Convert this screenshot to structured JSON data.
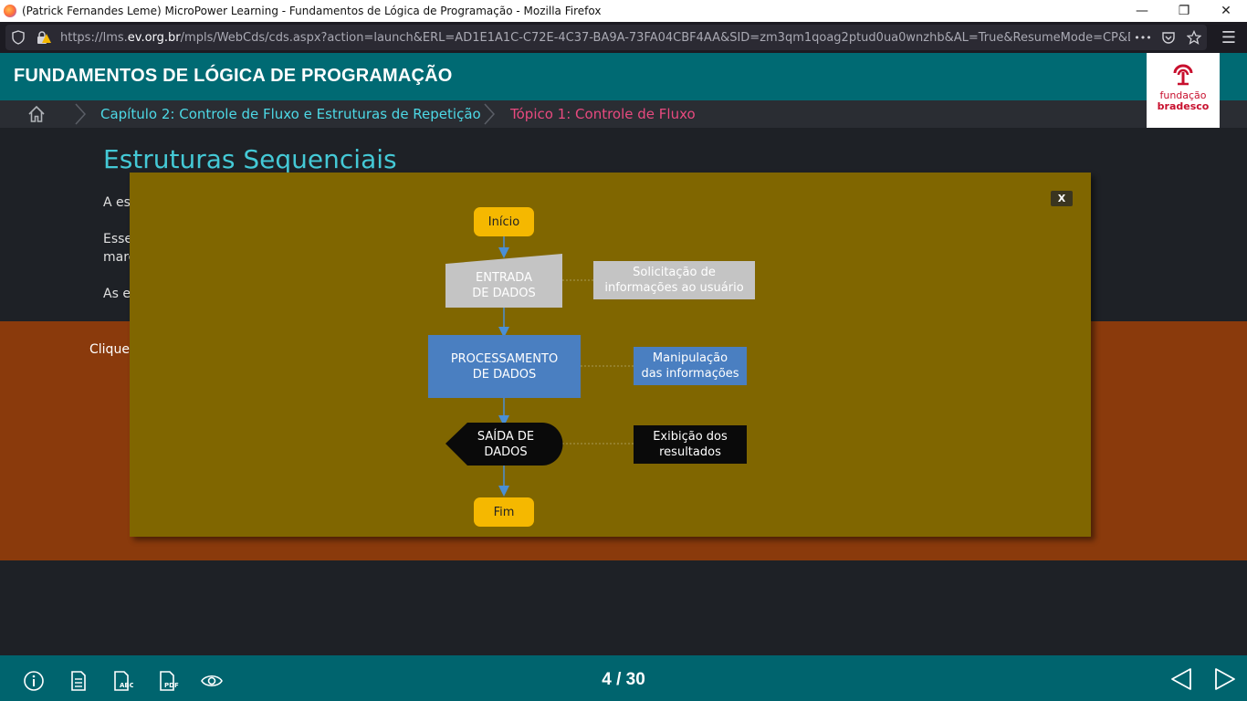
{
  "browser": {
    "window_title": "(Patrick Fernandes Leme) MicroPower Learning - Fundamentos de Lógica de Programação - Mozilla Firefox",
    "url_prefix": "https://lms.",
    "url_host": "ev.org.br",
    "url_rest": "/mpls/WebCds/cds.aspx?action=launch&ERL=AD1E1A1C-C72E-4C37-BA9A-73FA04CBF4AA&SID=zm3qm1qoag2ptud0ua0wnzhb&AL=True&ResumeMode=CP&DCM=A",
    "more": "•••"
  },
  "header": {
    "course_title": "FUNDAMENTOS DE LÓGICA DE PROGRAMAÇÃO",
    "logo_line1": "fundação",
    "logo_line2": "bradesco"
  },
  "breadcrumb": {
    "chapter": "Capítulo 2: Controle de Fluxo e Estruturas de Repetição",
    "topic": "Tópico 1: Controle de Fluxo"
  },
  "page": {
    "heading": "Estruturas Sequenciais",
    "para1": "A est",
    "para2a": "Esse",
    "para2b": "marc",
    "para3": "As es",
    "clique": "Clique"
  },
  "modal": {
    "close_label": "X",
    "flow": {
      "start": "Início",
      "input_l1": "ENTRADA",
      "input_l2": "DE DADOS",
      "input_note_l1": "Solicitação de",
      "input_note_l2": "informações ao usuário",
      "process_l1": "PROCESSAMENTO",
      "process_l2": "DE DADOS",
      "process_note_l1": "Manipulação",
      "process_note_l2": "das informações",
      "output_l1": "SAÍDA DE",
      "output_l2": "DADOS",
      "output_note_l1": "Exibição dos",
      "output_note_l2": "resultados",
      "end": "Fim"
    }
  },
  "footer": {
    "page_indicator": "4 / 30"
  },
  "colors": {
    "header_teal": "#006a73",
    "modal_olive": "#806600",
    "terminal_yellow": "#f5b800",
    "input_gray": "#c4c4c4",
    "process_blue": "#4a7fc1",
    "output_black": "#0a0a0a",
    "breadcrumb_chapter": "#4dd9e6",
    "breadcrumb_topic": "#e84a7f"
  }
}
